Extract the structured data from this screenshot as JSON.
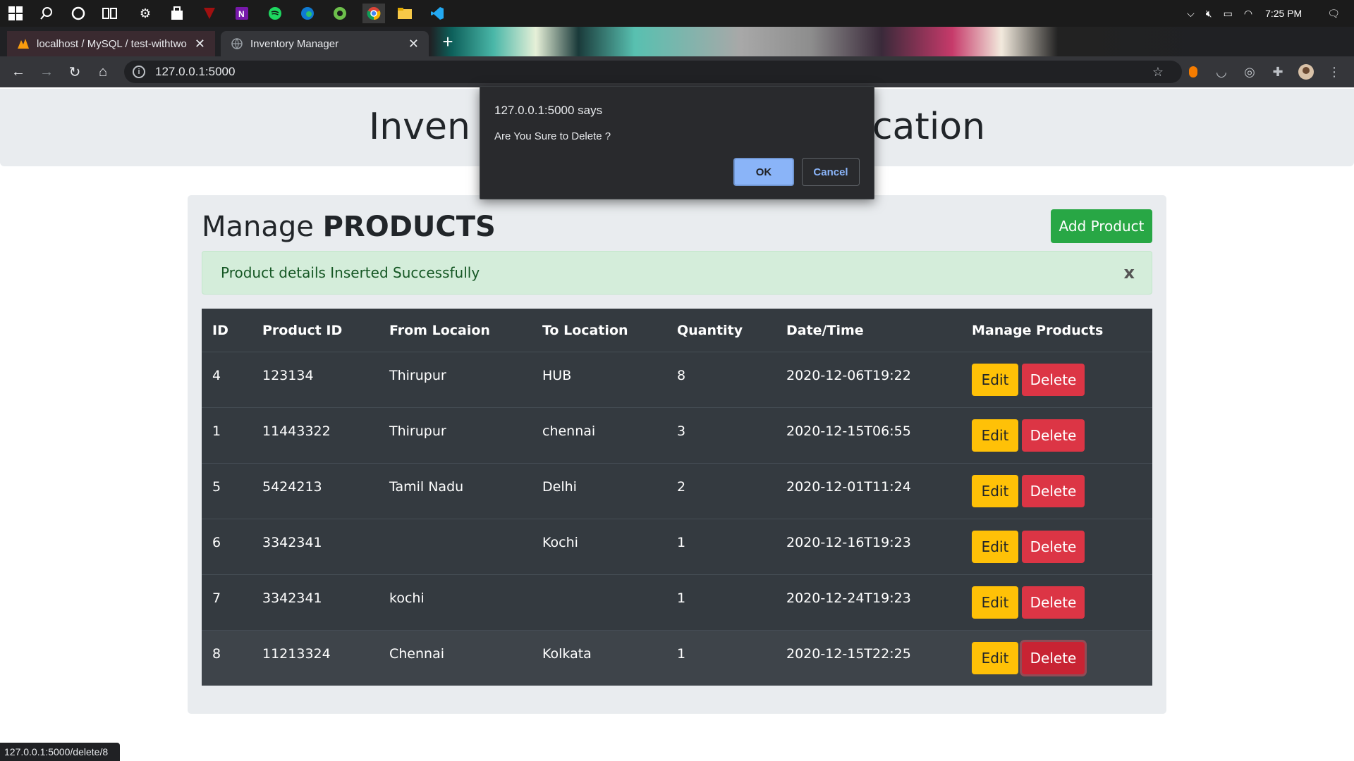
{
  "taskbar": {
    "icons": [
      "windows-start-icon",
      "search-icon",
      "cortana-icon",
      "task-view-icon",
      "settings-icon",
      "store-icon",
      "game-app-icon",
      "onenote-icon",
      "spotify-icon",
      "edge-icon",
      "app-icon",
      "chrome-icon",
      "file-explorer-icon",
      "vscode-icon"
    ],
    "tray": {
      "time": "7:25 PM"
    }
  },
  "browser": {
    "tabs": [
      {
        "title": "localhost / MySQL / test-withtwo",
        "active": false
      },
      {
        "title": "Inventory Manager",
        "active": true
      }
    ],
    "url": "127.0.0.1:5000",
    "status_url": "127.0.0.1:5000/delete/8"
  },
  "page": {
    "header_title": "Inventory Management Application",
    "header_left": "Inven",
    "header_right": "cation",
    "manage_word": "Manage",
    "products_word": "PRODUCTS",
    "add_button": "Add Product",
    "alert_text": "Product details Inserted Successfully",
    "alert_close": "x",
    "table": {
      "headers": [
        "ID",
        "Product ID",
        "From Locaion",
        "To Location",
        "Quantity",
        "Date/Time",
        "Manage Products"
      ],
      "rows": [
        {
          "id": "4",
          "product_id": "123134",
          "from": "Thirupur",
          "to": "HUB",
          "qty": "8",
          "datetime": "2020-12-06T19:22"
        },
        {
          "id": "1",
          "product_id": "11443322",
          "from": "Thirupur",
          "to": "chennai",
          "qty": "3",
          "datetime": "2020-12-15T06:55"
        },
        {
          "id": "5",
          "product_id": "5424213",
          "from": "Tamil Nadu",
          "to": "Delhi",
          "qty": "2",
          "datetime": "2020-12-01T11:24"
        },
        {
          "id": "6",
          "product_id": "3342341",
          "from": "",
          "to": "Kochi",
          "qty": "1",
          "datetime": "2020-12-16T19:23"
        },
        {
          "id": "7",
          "product_id": "3342341",
          "from": "kochi",
          "to": "",
          "qty": "1",
          "datetime": "2020-12-24T19:23"
        },
        {
          "id": "8",
          "product_id": "11213324",
          "from": "Chennai",
          "to": "Kolkata",
          "qty": "1",
          "datetime": "2020-12-15T22:25"
        }
      ],
      "edit_label": "Edit",
      "delete_label": "Delete"
    }
  },
  "dialog": {
    "title": "127.0.0.1:5000 says",
    "message": "Are You Sure to Delete ?",
    "ok": "OK",
    "cancel": "Cancel"
  },
  "colors": {
    "success": "#28a745",
    "warning": "#ffc107",
    "danger": "#dc3545",
    "table_dark": "#343a40",
    "dialog_accent": "#8ab4f8"
  }
}
